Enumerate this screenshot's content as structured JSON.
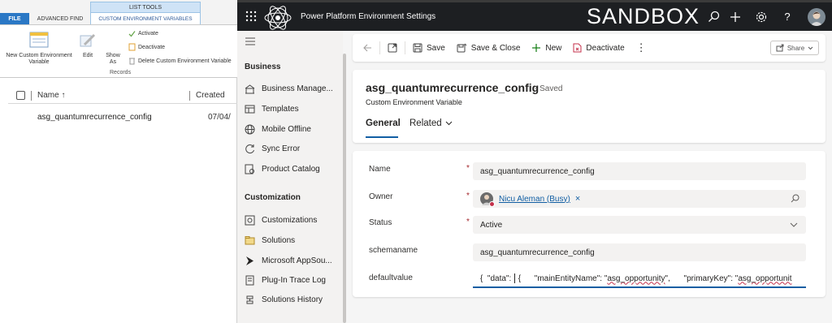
{
  "legacy": {
    "tabs": {
      "file": "FILE",
      "advanced_find": "ADVANCED FIND",
      "list_tools": "LIST TOOLS",
      "cev": "CUSTOM ENVIRONMENT VARIABLES"
    },
    "ribbon": {
      "new_label": "New Custom Environment Variable",
      "edit_label": "Edit",
      "show_as_label": "Show As",
      "activate_label": "Activate",
      "deactivate_label": "Deactivate",
      "delete_label": "Delete Custom Environment Variable",
      "group_label": "Records"
    },
    "grid": {
      "col_name": "Name ↑",
      "col_created": "Created",
      "rows": [
        {
          "name": "asg_quantumrecurrence_config",
          "created": "07/04/"
        }
      ]
    }
  },
  "topbar": {
    "app_title": "Power Platform Environment Settings",
    "environment": "SANDBOX",
    "icons": [
      "waffle-icon",
      "search-icon",
      "add-icon",
      "settings-icon",
      "help-icon",
      "avatar"
    ]
  },
  "sitemap": {
    "groups": [
      {
        "label": "Business",
        "items": [
          "Business Manage...",
          "Templates",
          "Mobile Offline",
          "Sync Error",
          "Product Catalog"
        ]
      },
      {
        "label": "Customization",
        "items": [
          "Customizations",
          "Solutions",
          "Microsoft AppSou...",
          "Plug-In Trace Log",
          "Solutions History"
        ]
      }
    ]
  },
  "commands": {
    "save": "Save",
    "save_close": "Save & Close",
    "new": "New",
    "deactivate": "Deactivate",
    "share": "Share"
  },
  "record": {
    "title": "asg_quantumrecurrence_config",
    "saved": "- Saved",
    "entity": "Custom Environment Variable",
    "tabs": {
      "general": "General",
      "related": "Related"
    }
  },
  "fields": {
    "name": {
      "label": "Name",
      "value": "asg_quantumrecurrence_config",
      "required": "*"
    },
    "owner": {
      "label": "Owner",
      "value": "Nicu Aleman (Busy)",
      "required": "*",
      "remove": "×"
    },
    "status": {
      "label": "Status",
      "value": "Active",
      "required": "*"
    },
    "schemaname": {
      "label": "schemaname",
      "value": "asg_quantumrecurrence_config"
    },
    "defaultvalue": {
      "label": "defaultvalue",
      "value_a": "{  \"data\": ",
      "value_b": " {      \"mainEntityName\": \"",
      "value_c": "asg_opportunity",
      "value_d": "\",      \"primaryKey\": \"",
      "value_e": "asg_opportunit"
    }
  },
  "colors": {
    "topbar": "#1d1f22",
    "accent": "#115ea3",
    "required": "#a4262c",
    "file_tab": "#2b78c5"
  }
}
